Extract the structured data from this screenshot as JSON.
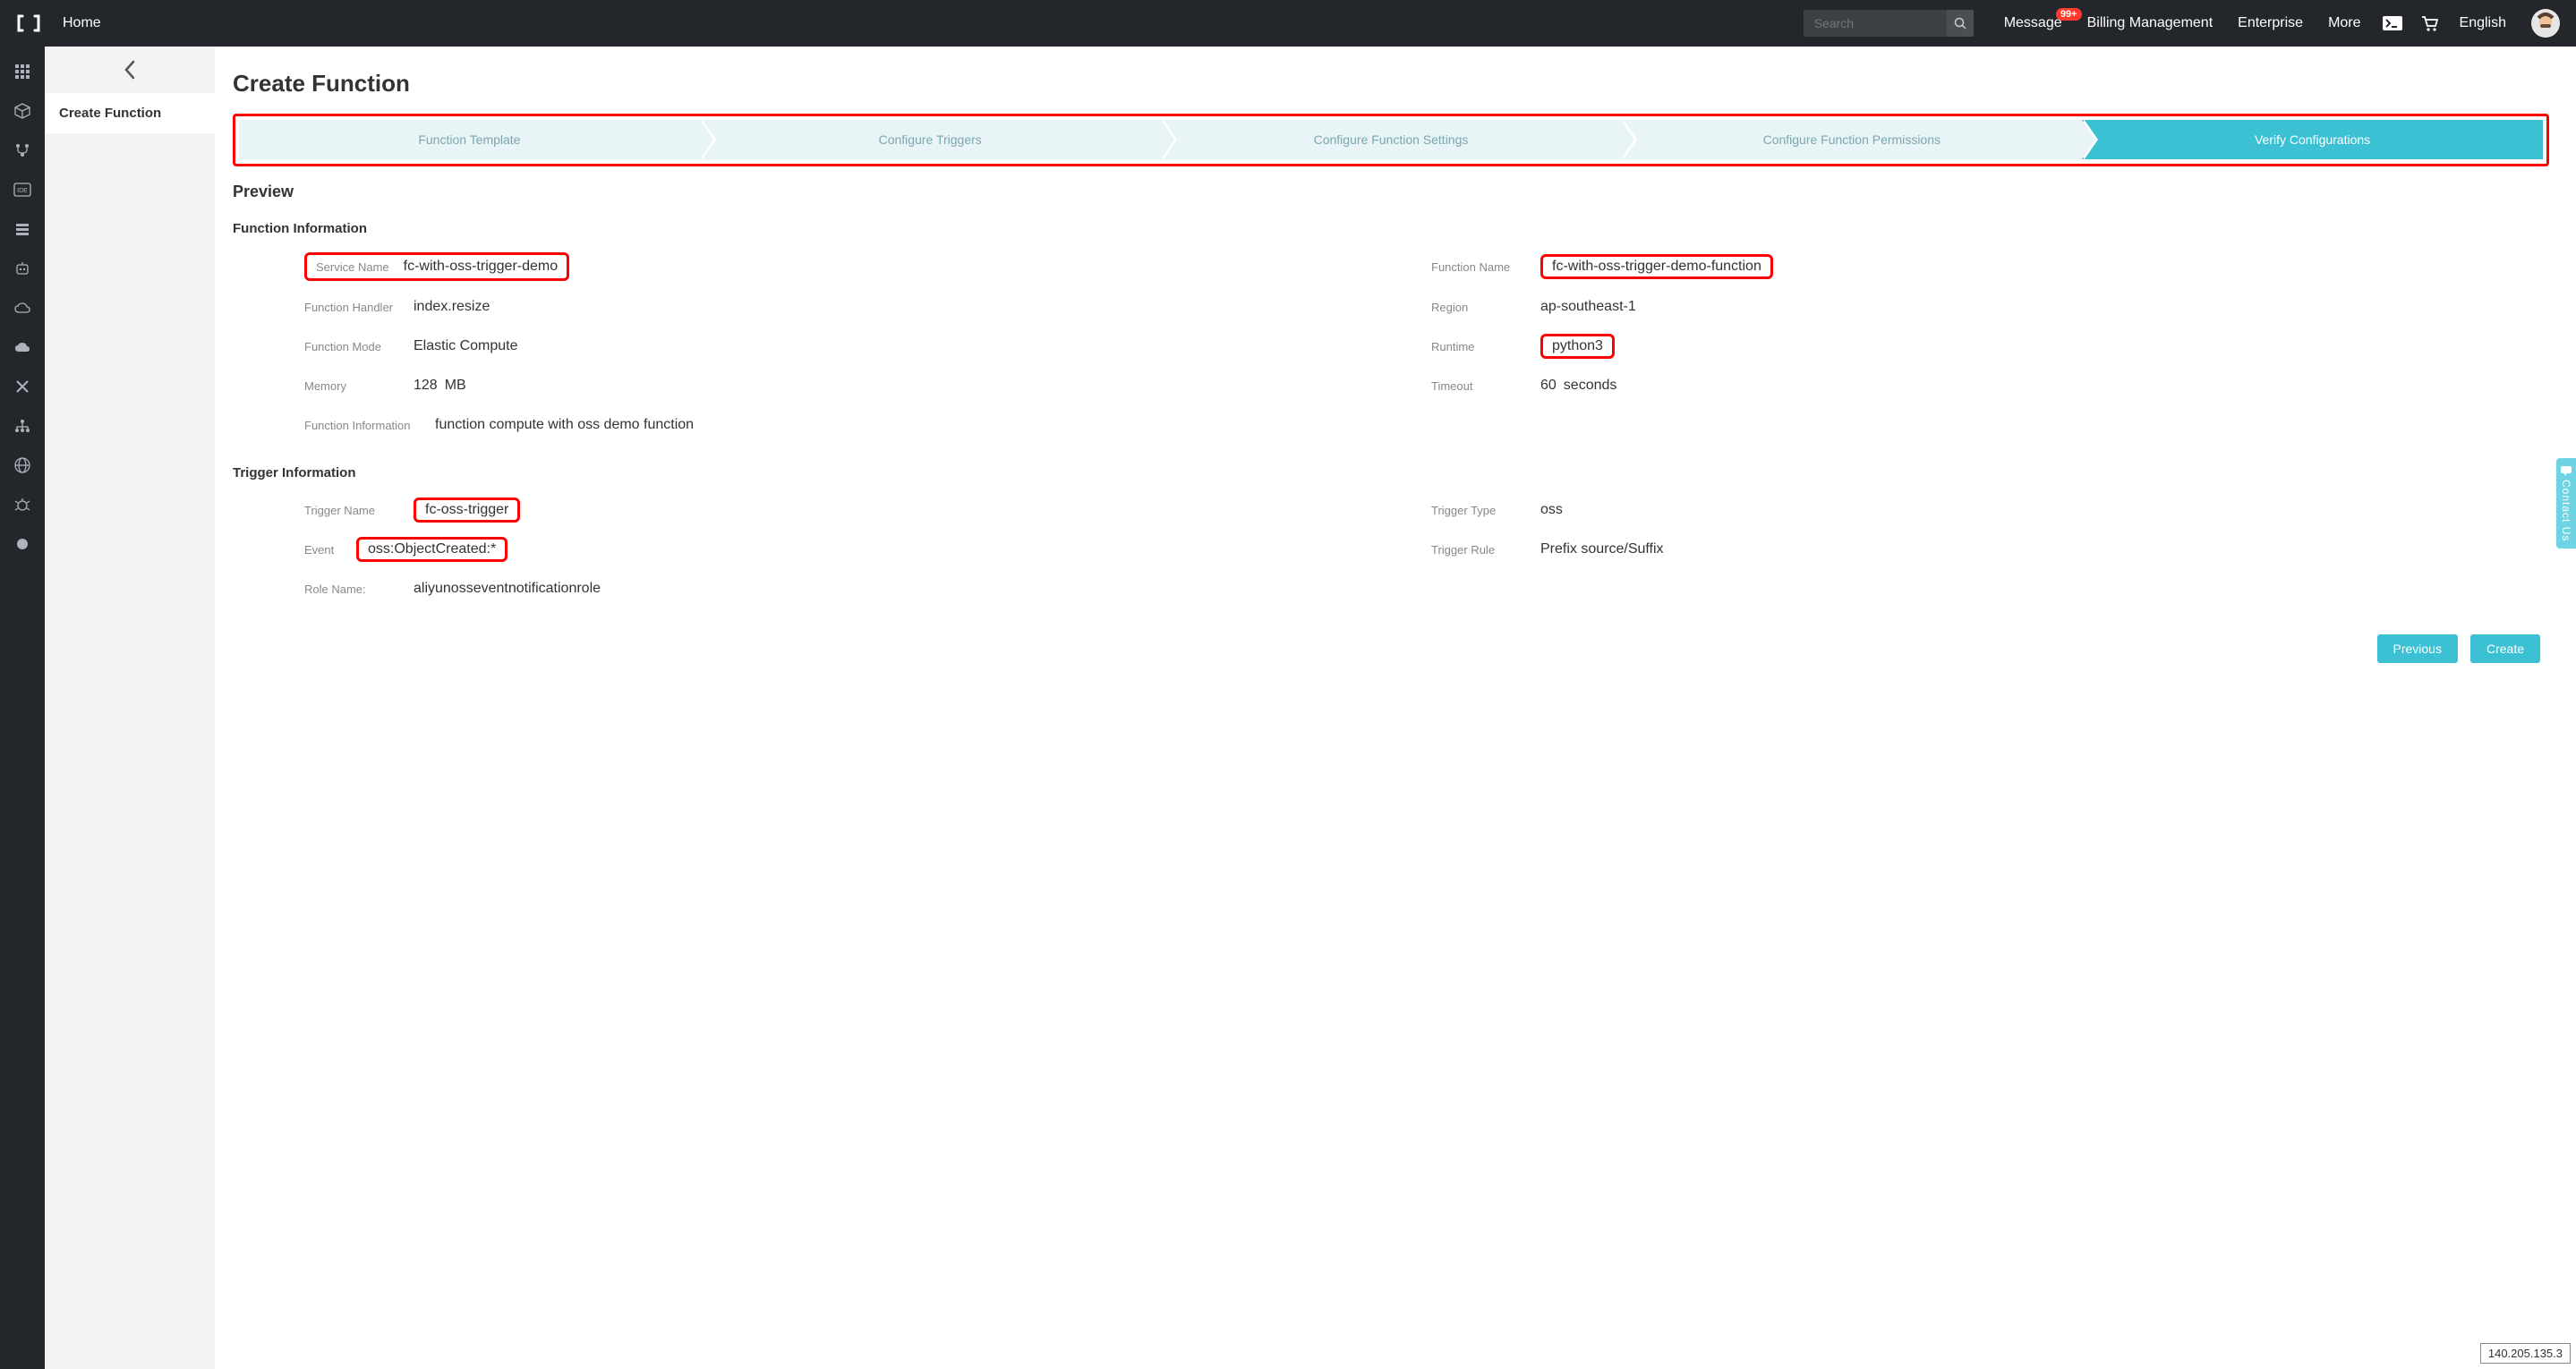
{
  "topbar": {
    "home": "Home",
    "search_placeholder": "Search",
    "message": "Message",
    "badge": "99+",
    "billing": "Billing Management",
    "enterprise": "Enterprise",
    "more": "More",
    "language": "English"
  },
  "sidebar": {
    "item": "Create Function"
  },
  "page": {
    "title": "Create Function",
    "preview": "Preview"
  },
  "steps": {
    "s1": "Function Template",
    "s2": "Configure Triggers",
    "s3": "Configure Function Settings",
    "s4": "Configure Function Permissions",
    "s5": "Verify Configurations"
  },
  "func_info_heading": "Function Information",
  "func": {
    "service_name_k": "Service Name",
    "service_name_v": "fc-with-oss-trigger-demo",
    "function_name_k": "Function Name",
    "function_name_v": "fc-with-oss-trigger-demo-function",
    "handler_k": "Function Handler",
    "handler_v": "index.resize",
    "region_k": "Region",
    "region_v": "ap-southeast-1",
    "mode_k": "Function Mode",
    "mode_v": "Elastic Compute",
    "runtime_k": "Runtime",
    "runtime_v": "python3",
    "memory_k": "Memory",
    "memory_v": "128",
    "memory_unit": "MB",
    "timeout_k": "Timeout",
    "timeout_v": "60",
    "timeout_unit": "seconds",
    "desc_k": "Function Information",
    "desc_v": "function compute with oss demo function"
  },
  "trigger_info_heading": "Trigger Information",
  "trig": {
    "name_k": "Trigger Name",
    "name_v": "fc-oss-trigger",
    "type_k": "Trigger Type",
    "type_v": "oss",
    "event_k": "Event",
    "event_v": "oss:ObjectCreated:*",
    "rule_k": "Trigger Rule",
    "rule_v": "Prefix source/Suffix",
    "role_k": "Role Name:",
    "role_v": "aliyunosseventnotificationrole"
  },
  "actions": {
    "previous": "Previous",
    "create": "Create"
  },
  "contact": "Contact Us",
  "ip": "140.205.135.3"
}
